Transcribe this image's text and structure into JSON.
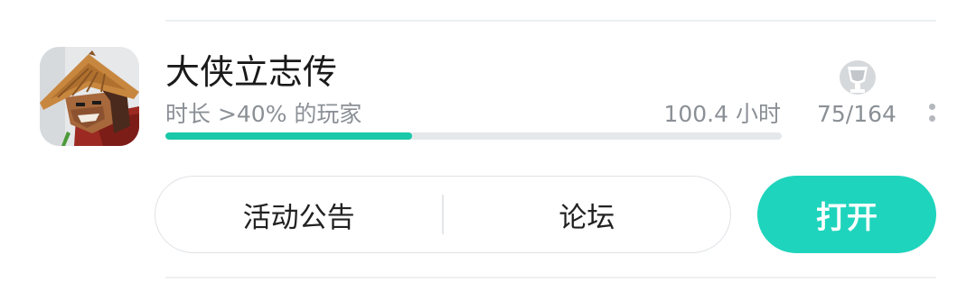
{
  "game": {
    "title": "大侠立志传",
    "playtime_rank": "时长 >40% 的玩家",
    "playtime": "100.4 小时",
    "playtime_progress": 0.4,
    "achievements": "75/164",
    "icon": "game-cover-swordsman-straw-hat",
    "more_icon": "more-icon"
  },
  "actions": {
    "announcement_label": "活动公告",
    "forum_label": "论坛",
    "open_label": "打开"
  },
  "colors": {
    "accent": "#1fd4bc",
    "progress": "#19c8a8",
    "muted_text": "#8b9096"
  }
}
